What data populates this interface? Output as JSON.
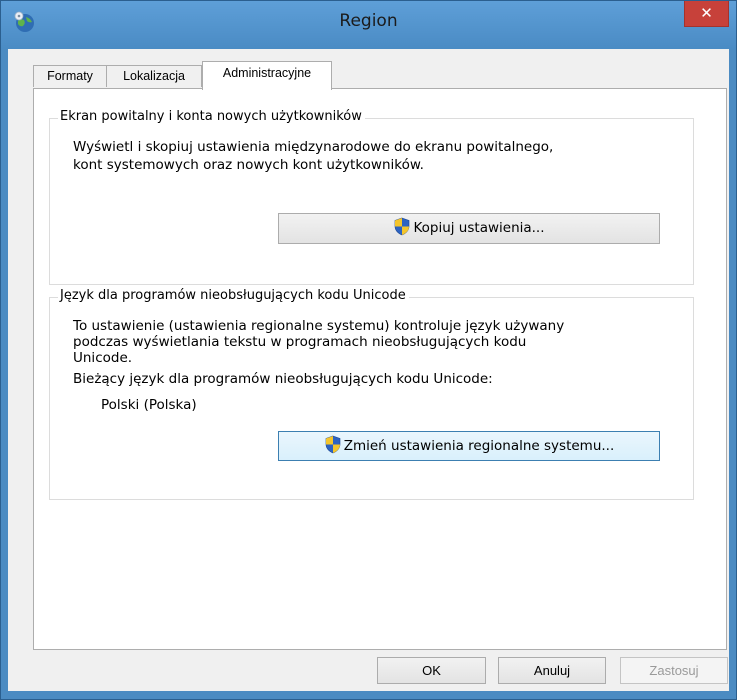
{
  "window": {
    "title": "Region",
    "close_label": "✕"
  },
  "tabs": [
    {
      "label": "Formaty"
    },
    {
      "label": "Lokalizacja"
    },
    {
      "label": "Administracyjne"
    }
  ],
  "welcome_group": {
    "label": "Ekran powitalny i konta nowych użytkowników",
    "description_line1": "Wyświetl i skopiuj ustawienia międzynarodowe do ekranu powitalnego,",
    "description_line2": "kont systemowych oraz nowych kont użytkowników.",
    "button_label": "Kopiuj ustawienia..."
  },
  "unicode_group": {
    "label": "Język dla programów nieobsługujących kodu Unicode",
    "description_line1": "To ustawienie (ustawienia regionalne systemu) kontroluje język używany",
    "description_line2": "podczas wyświetlania tekstu w programach nieobsługujących kodu",
    "description_line3": "Unicode.",
    "current_label": "Bieżący język dla programów nieobsługujących kodu Unicode:",
    "current_value": "Polski (Polska)",
    "button_label": "Zmień ustawienia regionalne systemu..."
  },
  "footer": {
    "ok_label": "OK",
    "cancel_label": "Anuluj",
    "apply_label": "Zastosuj"
  },
  "colors": {
    "titlebar": "#5e9fd8",
    "close_button": "#c7413a",
    "focus_border": "#3c7fb1"
  }
}
